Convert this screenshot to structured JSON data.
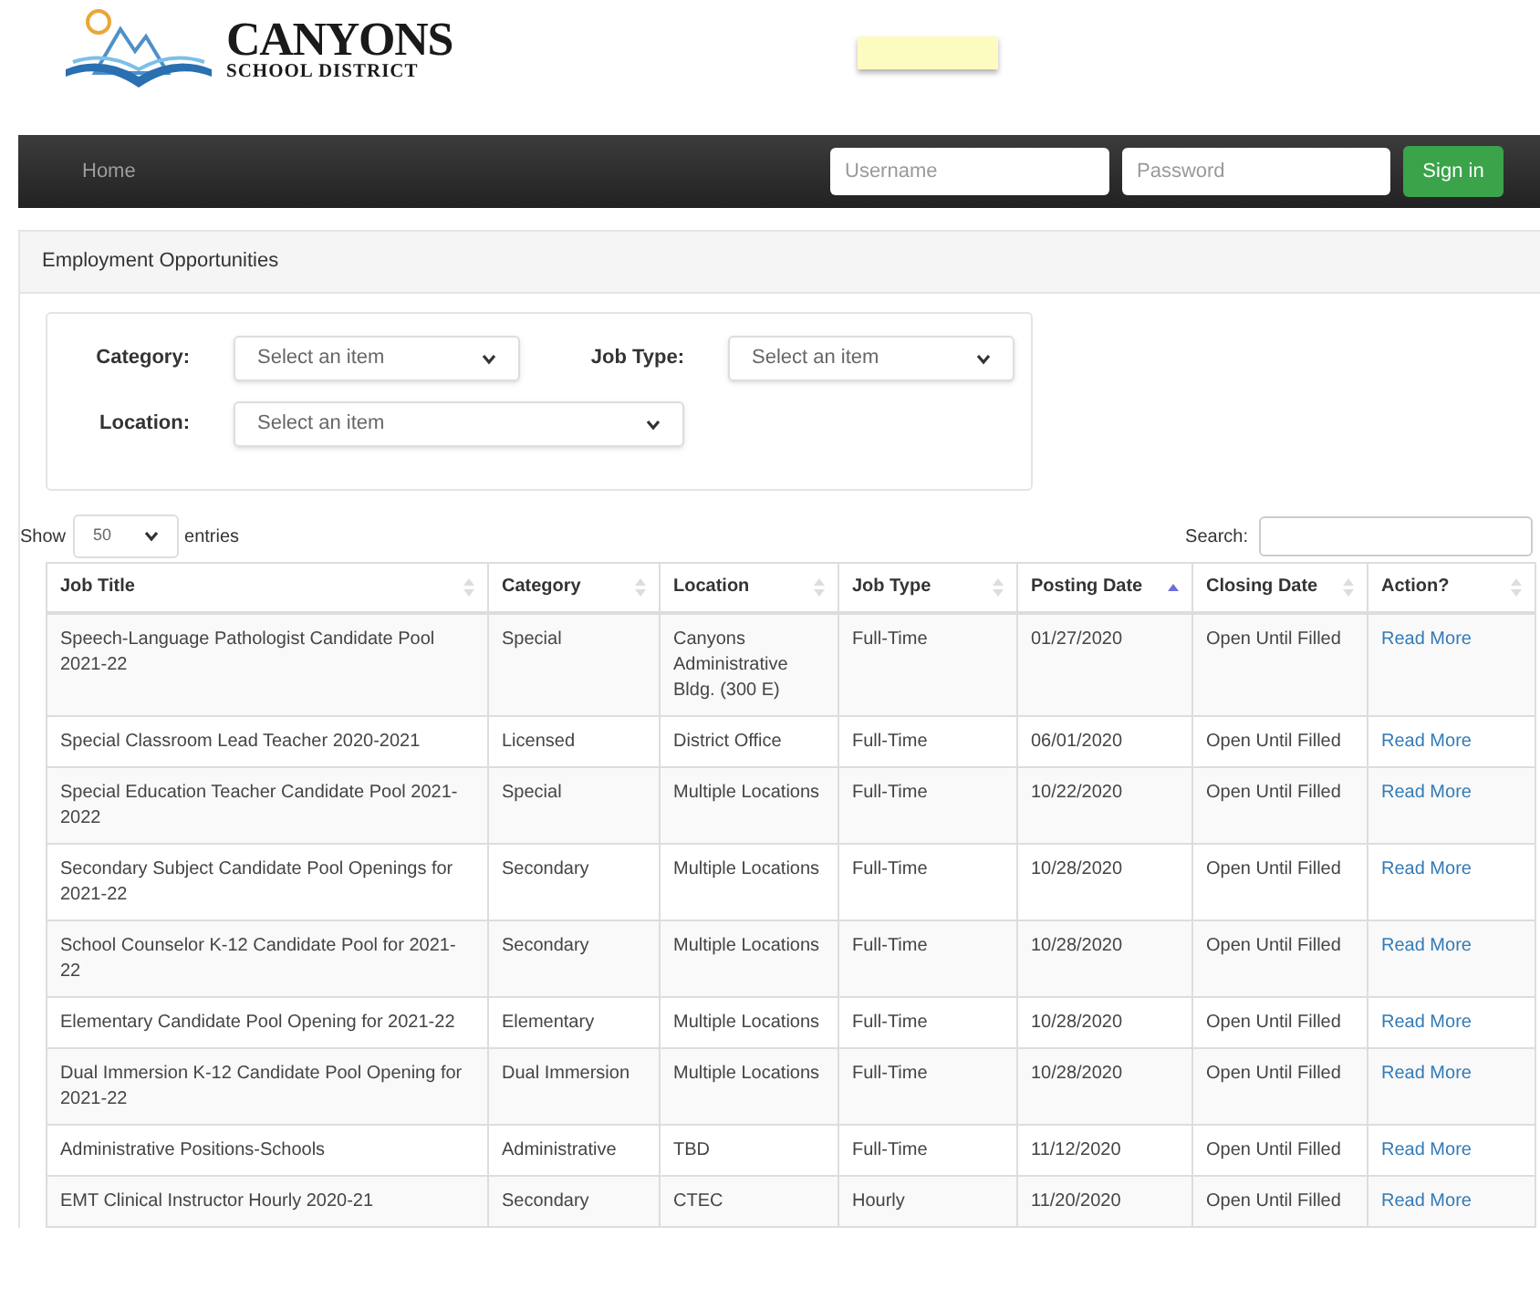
{
  "logo": {
    "name": "CANYONS",
    "subtitle": "SCHOOL DISTRICT"
  },
  "navbar": {
    "items": [
      {
        "label": "Home",
        "selected": false
      }
    ],
    "username": {
      "placeholder": "Username"
    },
    "password": {
      "placeholder": "Password"
    },
    "sign_in": "Sign in"
  },
  "panel": {
    "title": "Employment Opportunities"
  },
  "filters": [
    {
      "label": "Category:",
      "placeholder": "Select an item"
    },
    {
      "label": "Job Type:",
      "placeholder": "Select an item"
    },
    {
      "label": "Location:",
      "placeholder": "Select an item"
    }
  ],
  "length_menu": {
    "before": "Show",
    "value": "50",
    "after": "entries"
  },
  "search": {
    "label": "Search:"
  },
  "table": {
    "columns": [
      {
        "label": "Job Title",
        "sorted": false
      },
      {
        "label": "Category",
        "sorted": false
      },
      {
        "label": "Location",
        "sorted": false
      },
      {
        "label": "Job Type",
        "sorted": false
      },
      {
        "label": "Posting Date",
        "sorted": true
      },
      {
        "label": "Closing Date",
        "sorted": false
      },
      {
        "label": "Action?",
        "sorted": false
      }
    ],
    "rows": [
      [
        "Speech-Language Pathologist Candidate Pool 2021-22",
        "Special",
        "Canyons Administrative Bldg. (300 E)",
        "Full-Time",
        "01/27/2020",
        "Open Until Filled",
        "Read More"
      ],
      [
        "Special Classroom Lead Teacher 2020-2021",
        "Licensed",
        "District Office",
        "Full-Time",
        "06/01/2020",
        "Open Until Filled",
        "Read More"
      ],
      [
        "Special Education Teacher Candidate Pool 2021-2022",
        "Special",
        "Multiple Locations",
        "Full-Time",
        "10/22/2020",
        "Open Until Filled",
        "Read More"
      ],
      [
        "Secondary Subject Candidate Pool Openings for 2021-22",
        "Secondary",
        "Multiple Locations",
        "Full-Time",
        "10/28/2020",
        "Open Until Filled",
        "Read More"
      ],
      [
        "School Counselor K-12 Candidate Pool for 2021-22",
        "Secondary",
        "Multiple Locations",
        "Full-Time",
        "10/28/2020",
        "Open Until Filled",
        "Read More"
      ],
      [
        "Elementary Candidate Pool Opening for 2021-22",
        "Elementary",
        "Multiple Locations",
        "Full-Time",
        "10/28/2020",
        "Open Until Filled",
        "Read More"
      ],
      [
        "Dual Immersion K-12 Candidate Pool Opening for 2021-22",
        "Dual Immersion",
        "Multiple Locations",
        "Full-Time",
        "10/28/2020",
        "Open Until Filled",
        "Read More"
      ],
      [
        "Administrative Positions-Schools",
        "Administrative",
        "TBD",
        "Full-Time",
        "11/12/2020",
        "Open Until Filled",
        "Read More"
      ],
      [
        "EMT Clinical Instructor Hourly 2020-21",
        "Secondary",
        "CTEC",
        "Hourly",
        "11/20/2020",
        "Open Until Filled",
        "Read More"
      ]
    ]
  }
}
